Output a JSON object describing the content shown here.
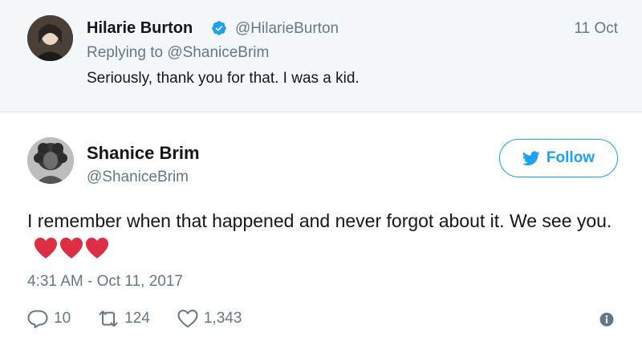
{
  "reply": {
    "author_name": "Hilarie Burton",
    "author_handle": "@HilarieBurton",
    "verified": true,
    "date": "11 Oct",
    "replying_to_prefix": "Replying to",
    "replying_to_handle": "@ShaniceBrim",
    "text": "Seriously, thank you for that. I was a kid."
  },
  "tweet": {
    "author_name": "Shanice Brim",
    "author_handle": "@ShaniceBrim",
    "follow_label": "Follow",
    "text": "I remember when that happened and never forgot about it. We see you.",
    "emoji": [
      "heart-icon",
      "heart-icon",
      "heart-icon"
    ],
    "timestamp": "4:31 AM - Oct 11, 2017",
    "actions": {
      "reply_count": "10",
      "retweet_count": "124",
      "like_count": "1,343"
    }
  },
  "colors": {
    "accent": "#1da1f2",
    "secondary_text": "#657786",
    "heart": "#e0245e",
    "reply_bg": "#f5f8fa"
  }
}
